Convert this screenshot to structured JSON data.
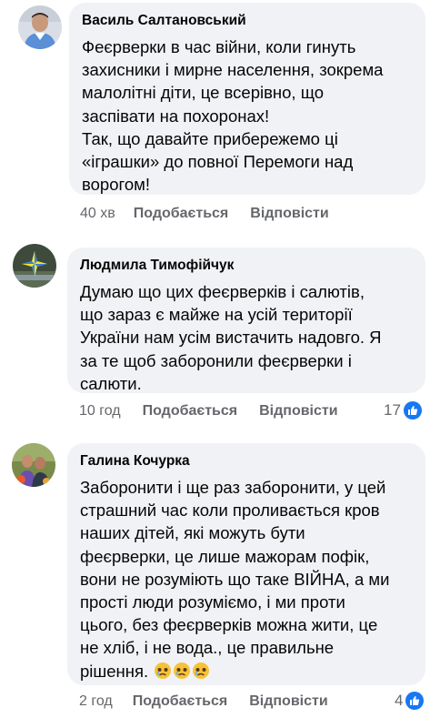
{
  "comments": [
    {
      "author": "Василь Салтановський",
      "lines": [
        "Феєрверки в час війни, коли гинуть",
        "захисники і мирне населення, зокрема",
        "малолітні діти, це всерівно, що",
        "заспівати на похоронах!",
        "Так, що давайте прибережемо ці",
        "«іграшки» до повної Перемоги над",
        "ворогом!"
      ],
      "time": "40 хв",
      "like_label": "Подобається",
      "reply_label": "Відповісти",
      "reaction_count": ""
    },
    {
      "author": "Людмила Тимофійчук",
      "lines": [
        "Думаю що цих феєрверків і салютів,",
        "що зараз є майже на усій території",
        "України нам усім вистачить надовго. Я",
        "за те щоб заборонили феєрверки і",
        "салюти."
      ],
      "time": "10 год",
      "like_label": "Подобається",
      "reply_label": "Відповісти",
      "reaction_count": "17"
    },
    {
      "author": "Галина Кочурка",
      "lines": [
        "Заборонити і ще раз заборонити, у цей",
        "страшний час коли проливається кров",
        "наших дітей,  які можуть бути",
        "феєрверки, це лише мажорам пофік,",
        "вони не розуміють що таке ВІЙНА, а ми",
        "прості люди розуміємо, і ми проти",
        "цього, без феєрверків можна жити, це",
        "не хліб, і не вода., це правильне",
        "рішення."
      ],
      "time": "2 год",
      "like_label": "Подобається",
      "reply_label": "Відповісти",
      "reaction_count": "4"
    }
  ],
  "colors": {
    "bubble": "#f0f2f5",
    "secondary_text": "#65676b",
    "like_blue": "#1877f2"
  },
  "icons": [
    "avatar-photo",
    "like-thumb-icon",
    "sad-face-emoji"
  ]
}
